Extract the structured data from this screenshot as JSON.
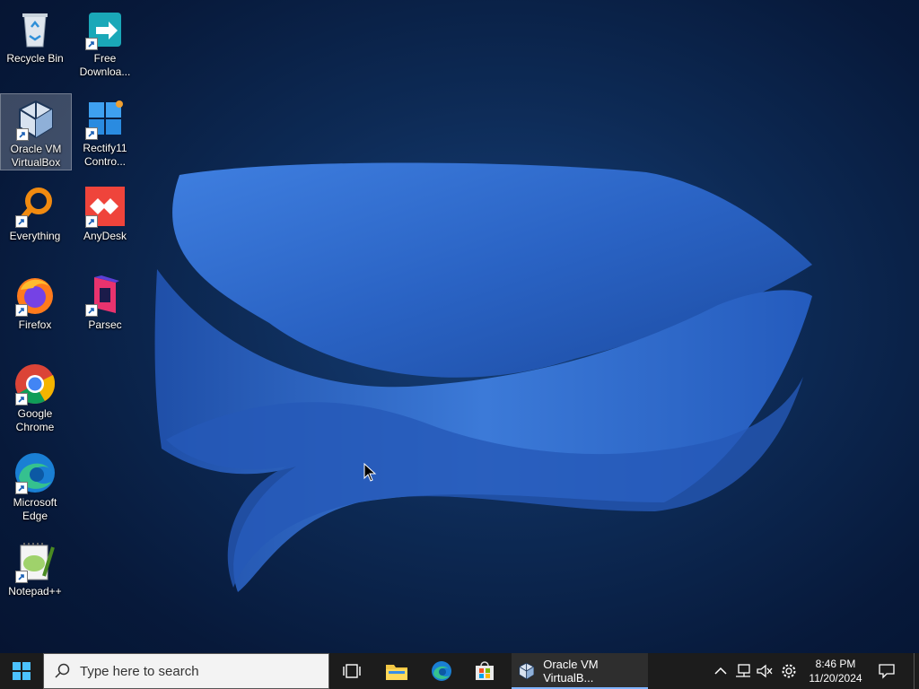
{
  "desktop": {
    "icons": [
      {
        "label": "Recycle Bin"
      },
      {
        "label": "Free Downloa..."
      },
      {
        "label": "Oracle VM VirtualBox"
      },
      {
        "label": "Rectify11 Contro..."
      },
      {
        "label": "Everything"
      },
      {
        "label": "AnyDesk"
      },
      {
        "label": "Firefox"
      },
      {
        "label": "Parsec"
      },
      {
        "label": "Google Chrome"
      },
      {
        "label": "Microsoft Edge"
      },
      {
        "label": "Notepad++"
      }
    ]
  },
  "taskbar": {
    "search_placeholder": "Type here to search",
    "running_app_label": "Oracle VM VirtualB...",
    "time": "8:46 PM",
    "date": "11/20/2024"
  },
  "colors": {
    "taskbar": "#1c1c1c",
    "accent": "#7fb4ff",
    "wallpaper_ribbon": "#2d6fd1"
  }
}
